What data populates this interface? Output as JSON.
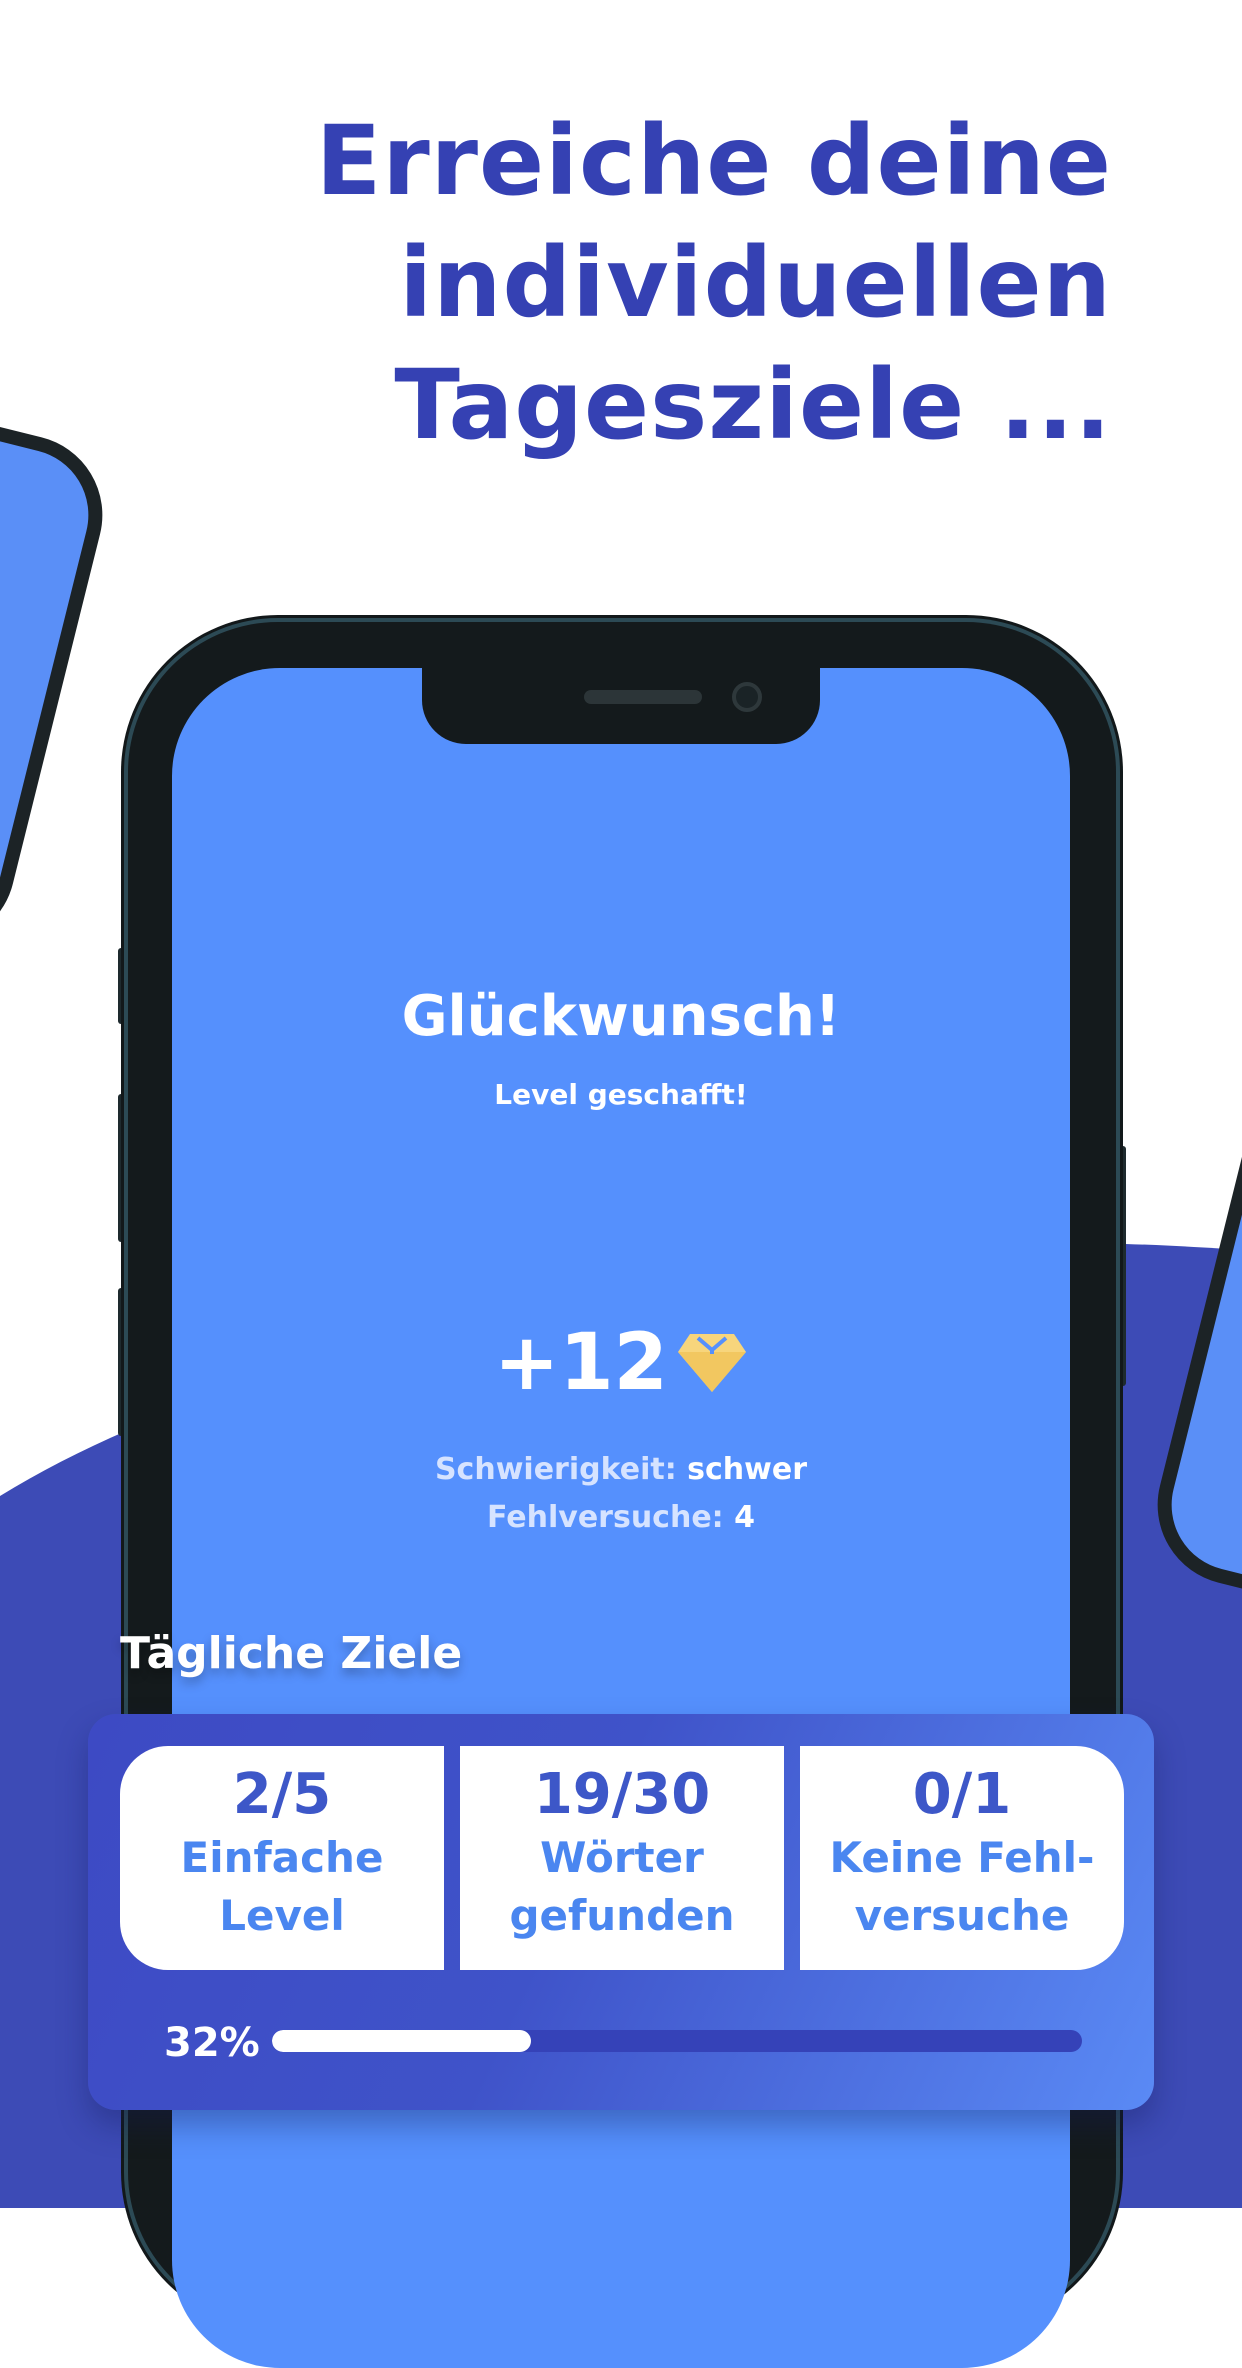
{
  "headline": {
    "line1": "Erreiche deine",
    "line2": "individuellen",
    "line3": "Tagesziele ..."
  },
  "colors": {
    "accent": "#3541b3",
    "screen": "#5590fd",
    "card": "#3f53c9"
  },
  "screen": {
    "title": "Glückwunsch!",
    "subtitle": "Level geschafft!",
    "reward": "+12",
    "reward_icon": "diamond-icon",
    "difficulty_label": "Schwierigkeit:",
    "difficulty_value": "schwer",
    "mistakes_label": "Fehlversuche:",
    "mistakes_value": "4"
  },
  "daily_goals": {
    "title": "Tägliche Ziele",
    "items": [
      {
        "value": "2/5",
        "line1": "Einfache",
        "line2": "Level"
      },
      {
        "value": "19/30",
        "line1": "Wörter",
        "line2": "gefunden"
      },
      {
        "value": "0/1",
        "line1": "Keine Fehl-",
        "line2": "versuche"
      }
    ],
    "progress_label": "32%",
    "progress": 0.32
  }
}
